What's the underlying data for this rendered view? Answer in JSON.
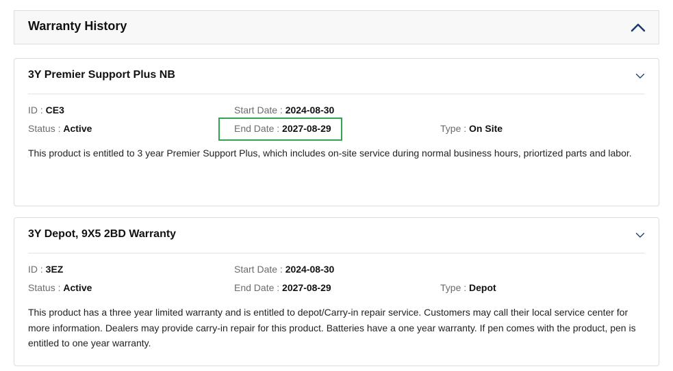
{
  "header": {
    "title": "Warranty History",
    "collapse_icon": "chevron-up-icon"
  },
  "accent_colors": {
    "chevron": "#1b3a6b",
    "highlight": "#2ea44f"
  },
  "warranties": [
    {
      "title": "3Y Premier Support Plus NB",
      "expand_icon": "chevron-down-icon",
      "id_label": "ID",
      "id": "CE3",
      "start_label": "Start Date",
      "start_date": "2024-08-30",
      "status_label": "Status",
      "status": "Active",
      "end_label": "End Date",
      "end_date": "2027-08-29",
      "type_label": "Type",
      "type": "On Site",
      "description": "This product is entitled to 3 year Premier Support Plus, which includes on-site service during normal business hours, priortized parts and labor."
    },
    {
      "title": "3Y Depot, 9X5 2BD Warranty",
      "expand_icon": "chevron-down-icon",
      "id_label": "ID",
      "id": "3EZ",
      "start_label": "Start Date",
      "start_date": "2024-08-30",
      "status_label": "Status",
      "status": "Active",
      "end_label": "End Date",
      "end_date": "2027-08-29",
      "type_label": "Type",
      "type": "Depot",
      "description": "This product has a three year limited warranty and is entitled to depot/Carry-in repair service. Customers may call their local service center for more information. Dealers may provide carry-in repair for this product. Batteries have a one year warranty. If pen comes with the product, pen is entitled to one year warranty."
    }
  ]
}
